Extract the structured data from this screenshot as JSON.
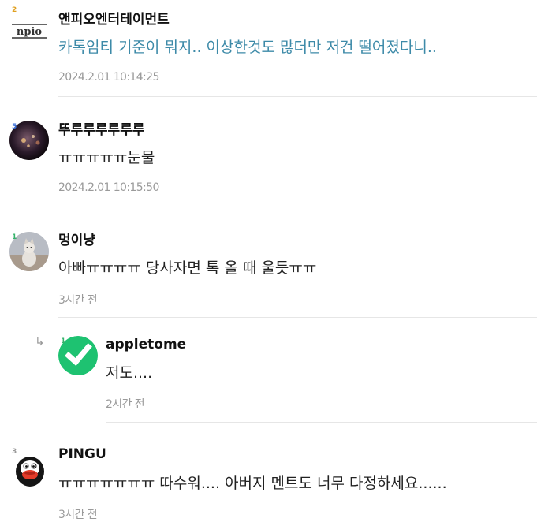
{
  "comments": [
    {
      "author": "앤피오엔터테이먼트",
      "text": "카톡임티 기준이 뭐지.. 이상한것도 많더만 저건 떨어졌다니..",
      "time": "2024.2.01 10:14:25",
      "avatar": "npio-logo",
      "avatar_text": "npio",
      "level_badge": "2",
      "badge_color": "#e0a020",
      "highlight": true
    },
    {
      "author": "뚜루루루루루루",
      "text": "ㅠㅠㅠㅠㅠ눈물",
      "time": "2024.2.01 10:15:50",
      "avatar": "night-lights-photo",
      "level_badge": "5",
      "badge_color": "#3a6fd8",
      "highlight": false
    },
    {
      "author": "멍이냥",
      "text": "아빠ㅠㅠㅠㅠ 당사자면 톡 올 때 울듯ㅠㅠ",
      "time": "3시간 전",
      "avatar": "cat-photo",
      "level_badge": "1",
      "badge_color": "#36b36b",
      "highlight": false
    },
    {
      "author": "appletome",
      "text": "저도....",
      "time": "2시간 전",
      "avatar": "green-check-circle",
      "level_badge": "1",
      "badge_color": "#36b36b",
      "reply_icon": "reply-arrow-icon",
      "reply_glyph": "↳",
      "highlight": false
    },
    {
      "author": "PINGU",
      "text": "ㅠㅠㅠㅠㅠㅠㅠ 따수워.... 아버지 멘트도 너무 다정하세요......",
      "time": "3시간 전",
      "avatar": "penguin-character",
      "level_badge": "3",
      "badge_color": "#9a9a9a",
      "highlight": false
    }
  ]
}
